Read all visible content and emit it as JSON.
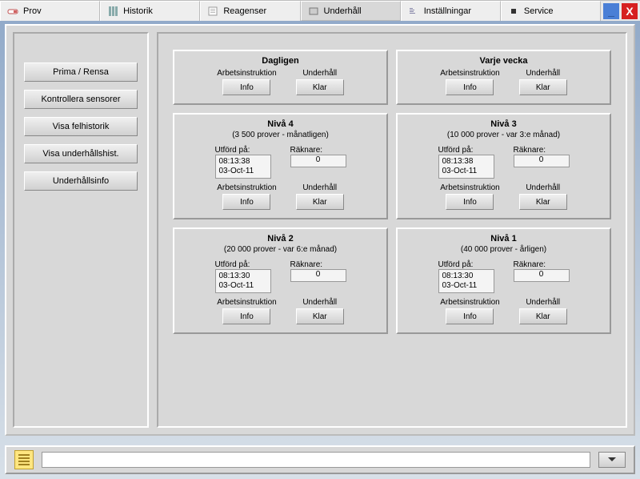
{
  "tabs": {
    "prov": "Prov",
    "historik": "Historik",
    "reagenser": "Reagenser",
    "underhall": "Underhåll",
    "installningar": "Inställningar",
    "service": "Service"
  },
  "sidebar": {
    "prima_rensa": "Prima / Rensa",
    "kontrollera": "Kontrollera sensorer",
    "felhistorik": "Visa felhistorik",
    "underhallshist": "Visa underhållshist.",
    "underhallsinfo": "Underhållsinfo"
  },
  "labels": {
    "arbetsinstruktion": "Arbetsinstruktion",
    "underhall_btn": "Underhåll",
    "info": "Info",
    "klar": "Klar",
    "utford_pa": "Utförd på:",
    "raknare": "Räknare:"
  },
  "cards": {
    "dagligen": {
      "title": "Dagligen"
    },
    "varje_vecka": {
      "title": "Varje vecka"
    },
    "niva4": {
      "title": "Nivå 4",
      "sub": "(3 500 prover - månatligen)",
      "utford": "08:13:38\n03-Oct-11",
      "raknare": "0"
    },
    "niva3": {
      "title": "Nivå 3",
      "sub": "(10 000 prover - var 3:e månad)",
      "utford": "08:13:38\n03-Oct-11",
      "raknare": "0"
    },
    "niva2": {
      "title": "Nivå 2",
      "sub": "(20 000 prover - var 6:e månad)",
      "utford": "08:13:30\n03-Oct-11",
      "raknare": "0"
    },
    "niva1": {
      "title": "Nivå 1",
      "sub": "(40 000 prover - årligen)",
      "utford": "08:13:30\n03-Oct-11",
      "raknare": "0"
    }
  },
  "statusbar": {
    "value": ""
  }
}
